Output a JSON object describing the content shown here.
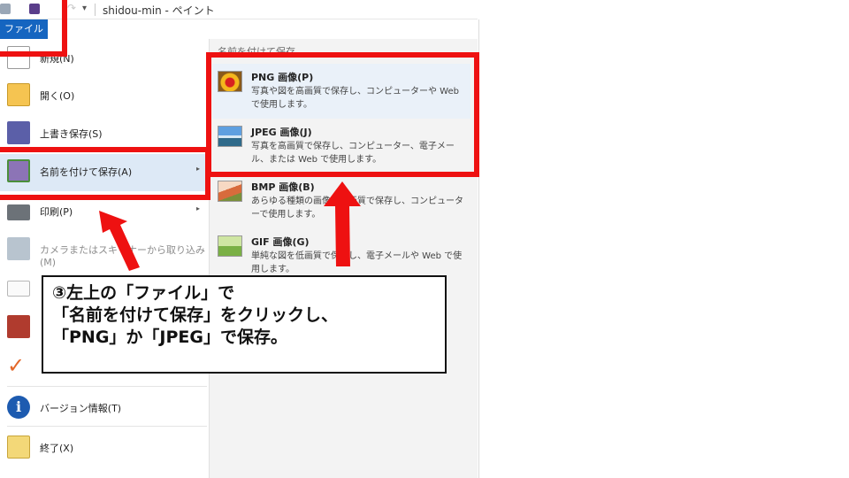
{
  "titlebar": {
    "title": "shidou-min - ペイント",
    "redo_glyph": "↷",
    "caret_glyph": "▾"
  },
  "file_tab": {
    "label": "ファイル"
  },
  "menu": {
    "items": [
      {
        "label": "新規(N)",
        "icon": "new-file-icon"
      },
      {
        "label": "開く(O)",
        "icon": "open-folder-icon"
      },
      {
        "label": "上書き保存(S)",
        "icon": "save-disk-icon"
      },
      {
        "label": "名前を付けて保存(A)",
        "icon": "save-as-icon"
      },
      {
        "label": "印刷(P)",
        "icon": "printer-icon"
      },
      {
        "label": "カメラまたはスキャナーから取り込み(M)",
        "icon": "camera-scanner-icon"
      },
      {
        "label": "",
        "icon": "email-icon"
      },
      {
        "label": "",
        "icon": "desktop-background-icon"
      },
      {
        "label": "",
        "icon": "checkmark-icon"
      },
      {
        "label": "バージョン情報(T)",
        "icon": "info-icon"
      },
      {
        "label": "終了(X)",
        "icon": "exit-icon"
      }
    ],
    "submenu_arrow": "▸",
    "check_glyph": "✓",
    "info_glyph": "i"
  },
  "submenu": {
    "header": "名前を付けて保存",
    "items": [
      {
        "title": "PNG 画像(P)",
        "desc": "写真や図を高画質で保存し、コンピューターや Web で使用します。",
        "icon": "png-image-icon"
      },
      {
        "title": "JPEG 画像(J)",
        "desc": "写真を高画質で保存し、コンピューター、電子メール、または Web で使用します。",
        "icon": "jpeg-image-icon"
      },
      {
        "title": "BMP 画像(B)",
        "desc": "あらゆる種類の画像を高画質で保存し、コンピューターで使用します。",
        "icon": "bmp-image-icon"
      },
      {
        "title": "GIF 画像(G)",
        "desc": "単純な図を低画質で保存し、電子メールや Web で使用します。",
        "icon": "gif-image-icon"
      }
    ]
  },
  "annotation": {
    "line1": "③左上の「ファイル」で",
    "line2": "「名前を付けて保存」をクリックし、",
    "line3": "「PNG」か「JPEG」で保存。"
  },
  "colors": {
    "highlight": "#ee1111",
    "file_tab": "#1565c0",
    "selected_row": "#dde9f6"
  }
}
